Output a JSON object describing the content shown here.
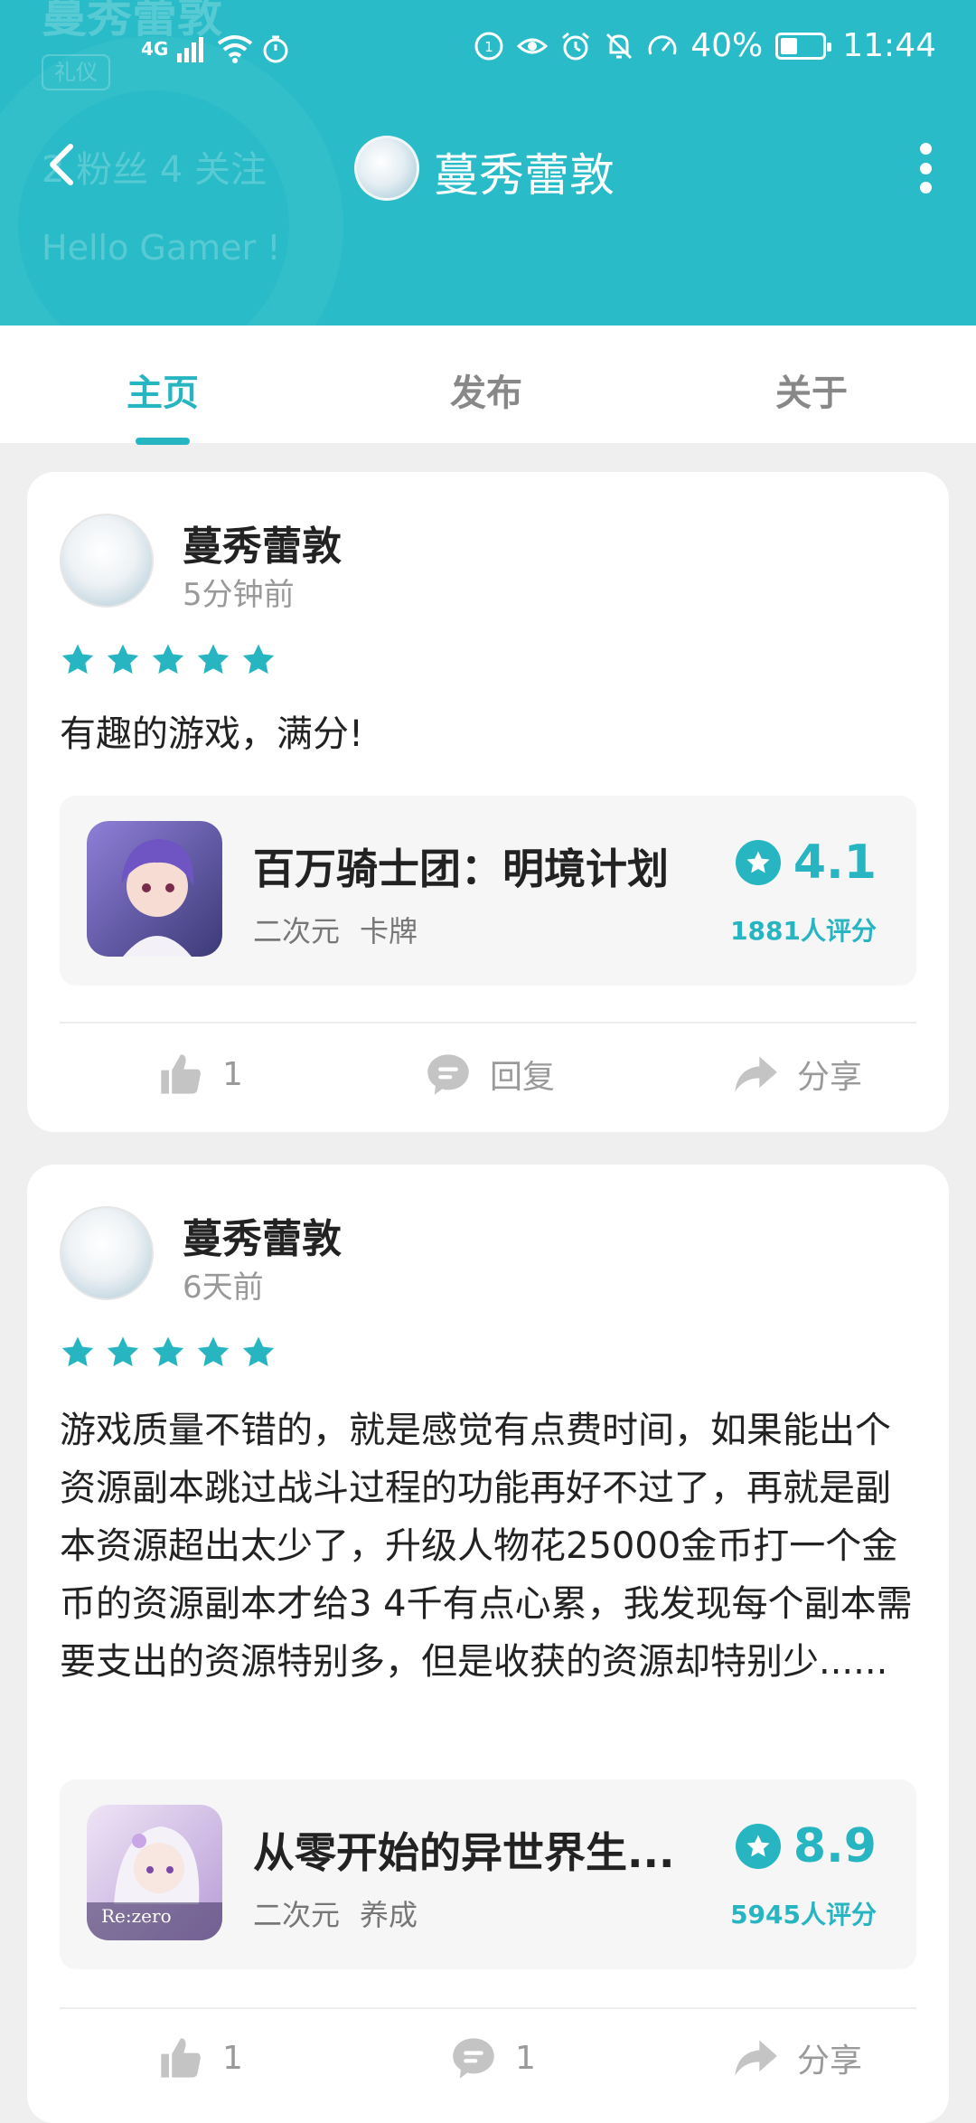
{
  "status_bar": {
    "network": "4G",
    "battery": "40%",
    "battery_level": 0.4,
    "time": "11:44"
  },
  "profile_header_ghost": {
    "name": "蔓秀蕾敦",
    "badge": "礼仪",
    "stats": "2 粉丝    4 关注",
    "bio": "Hello Gamer !"
  },
  "nav": {
    "title": "蔓秀蕾敦"
  },
  "tabs": [
    {
      "label": "主页",
      "active": true
    },
    {
      "label": "发布",
      "active": false
    },
    {
      "label": "关于",
      "active": false
    }
  ],
  "posts": [
    {
      "author": "蔓秀蕾敦",
      "time": "5分钟前",
      "stars": 5,
      "review": "有趣的游戏，满分!",
      "game": {
        "name": "百万骑士团：明境计划",
        "tags": [
          "二次元",
          "卡牌"
        ],
        "score": "4.1",
        "raters": "1881人评分",
        "icon": "anime-girl-purple-hair"
      },
      "actions": {
        "like_count": "1",
        "reply_label": "回复",
        "share_label": "分享"
      }
    },
    {
      "author": "蔓秀蕾敦",
      "time": "6天前",
      "stars": 5,
      "review": "游戏质量不错的，就是感觉有点费时间，如果能出个资源副本跳过战斗过程的功能再好不过了，再就是副本资源超出太少了，升级人物花25000金币打一个金币的资源副本才给3 4千有点心累，我发现每个副本需要支出的资源特别多，但是收获的资源却特别少......",
      "game": {
        "name": "从零开始的异世界生...",
        "tags": [
          "二次元",
          "养成"
        ],
        "score": "8.9",
        "raters": "5945人评分",
        "icon": "anime-girl-silver-hair",
        "icon_text": "Re:zero"
      },
      "actions": {
        "like_count": "1",
        "reply_count": "1",
        "share_label": "分享"
      }
    }
  ],
  "colors": {
    "accent": "#27b5c2",
    "header": "#29bcc8",
    "background": "#efefef"
  }
}
